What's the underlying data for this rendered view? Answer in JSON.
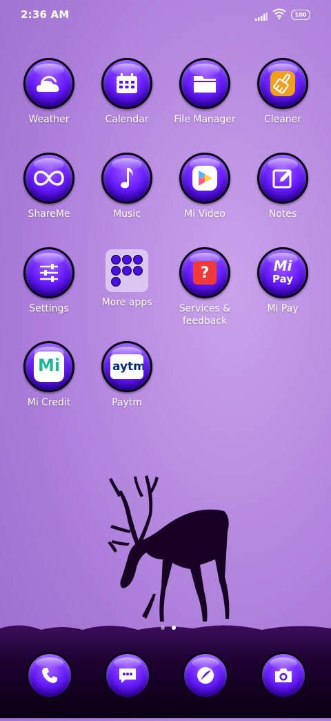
{
  "status_bar": {
    "time": "2:36 AM",
    "battery": "100"
  },
  "apps": [
    {
      "label": "Weather"
    },
    {
      "label": "Calendar"
    },
    {
      "label": "File Manager"
    },
    {
      "label": "Cleaner"
    },
    {
      "label": "ShareMe"
    },
    {
      "label": "Music"
    },
    {
      "label": "Mi Video"
    },
    {
      "label": "Notes"
    },
    {
      "label": "Settings"
    },
    {
      "label": "More apps"
    },
    {
      "label": "Services &\nfeedback"
    },
    {
      "label": "Mi Pay",
      "badge_line1": "Mi",
      "badge_line2": "Pay"
    },
    {
      "label": "Mi Credit",
      "badge": "Mi"
    },
    {
      "label": "Paytm",
      "badge": "aytm"
    }
  ],
  "page_indicator": {
    "pages": 2,
    "current": 2
  },
  "dock": [
    "phone-icon",
    "messages-icon",
    "browser-icon",
    "camera-icon"
  ],
  "colors": {
    "orb": "#5a14f0",
    "background": "#b48be0"
  }
}
